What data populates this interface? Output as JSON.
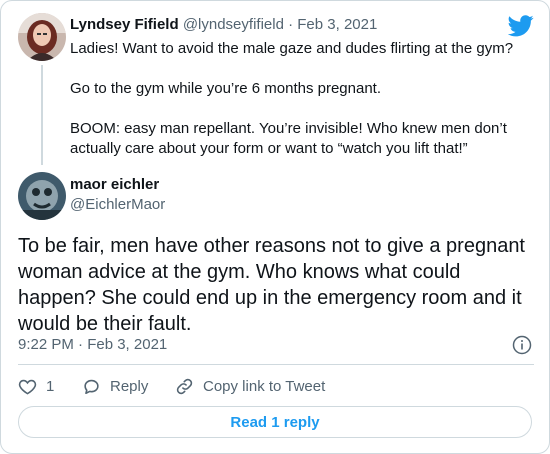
{
  "quoted_tweet": {
    "author_name": "Lyndsey Fifield",
    "handle": "@lyndseyfifield",
    "separator": "·",
    "date": "Feb 3, 2021",
    "paragraphs": [
      "Ladies! Want to avoid the male gaze and dudes flirting at the gym?",
      "Go to the gym while you’re 6 months pregnant.",
      "BOOM: easy man repellant. You’re invisible! Who knew men don’t actually care about your form or want to “watch you lift that!”"
    ]
  },
  "reply_tweet": {
    "author_name": "maor eichler",
    "handle": "@EichlerMaor",
    "text": "To be fair, men have other reasons not to give a pregnant woman advice at the gym. Who knows what could happen? She could end up in the emergency room and it would be their fault.",
    "timestamp": "9:22 PM · Feb 3, 2021"
  },
  "actions": {
    "like_count": "1",
    "reply_label": "Reply",
    "copy_link_label": "Copy link to Tweet"
  },
  "read_replies_label": "Read 1 reply",
  "icons": {
    "brand": "twitter-bird-icon",
    "info": "info-icon",
    "like": "heart-icon",
    "reply": "speech-bubble-icon",
    "copy": "link-icon"
  },
  "colors": {
    "accent": "#1d9bf0",
    "text_primary": "#0f1419",
    "text_secondary": "#536471",
    "border": "#cfd9de"
  }
}
